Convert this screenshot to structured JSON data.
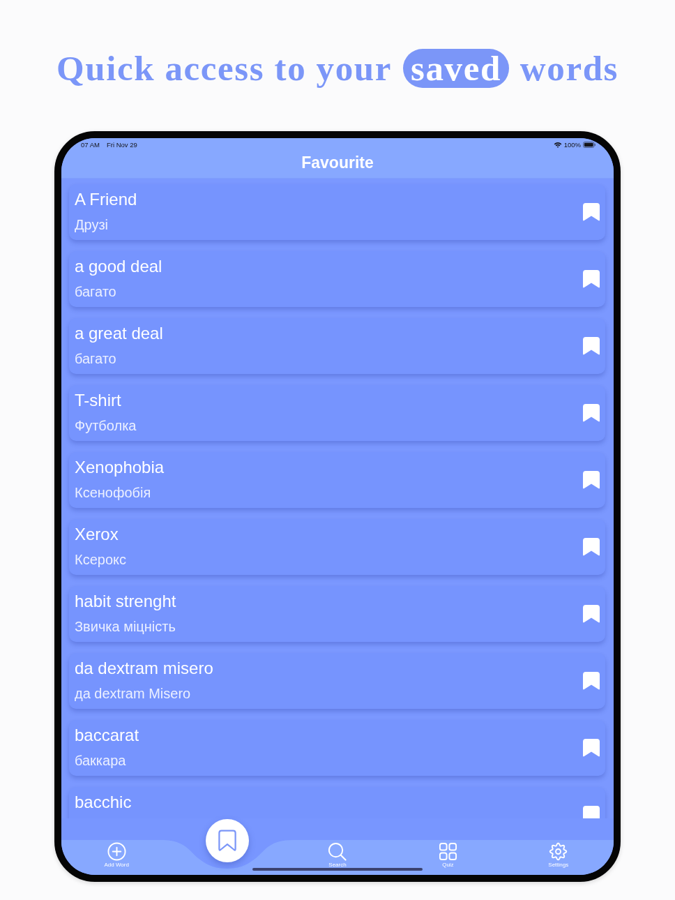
{
  "headline": {
    "before": "Quick access to your",
    "highlight": "saved",
    "after": "words"
  },
  "status_bar": {
    "time": "07 AM",
    "date": "Fri Nov 29",
    "battery": "100%"
  },
  "nav": {
    "title": "Favourite"
  },
  "words": [
    {
      "word": "A Friend",
      "translation": "Друзі",
      "bookmarked": true
    },
    {
      "word": "a good deal",
      "translation": "багато",
      "bookmarked": true
    },
    {
      "word": "a great deal",
      "translation": "багато",
      "bookmarked": true
    },
    {
      "word": "T-shirt",
      "translation": "Футболка",
      "bookmarked": true
    },
    {
      "word": "Xenophobia",
      "translation": "Ксенофобія",
      "bookmarked": true
    },
    {
      "word": "Xerox",
      "translation": "Ксерокс",
      "bookmarked": true
    },
    {
      "word": "habit strenght",
      "translation": "Звичка міцність",
      "bookmarked": true
    },
    {
      "word": "da dextram misero",
      "translation": "да dextram Misero",
      "bookmarked": true
    },
    {
      "word": "baccarat",
      "translation": "баккара",
      "bookmarked": true
    },
    {
      "word": "bacchic",
      "bookmarked": true
    }
  ],
  "tab_bar": {
    "items": [
      {
        "kind": "add",
        "label": "Add Word",
        "selected": false
      },
      {
        "kind": "favourite",
        "selected": true
      },
      {
        "kind": "search",
        "label": "Search",
        "selected": false
      },
      {
        "kind": "quiz",
        "label": "Quiz",
        "selected": false
      },
      {
        "kind": "settings",
        "label": "Settings",
        "selected": false
      }
    ]
  }
}
